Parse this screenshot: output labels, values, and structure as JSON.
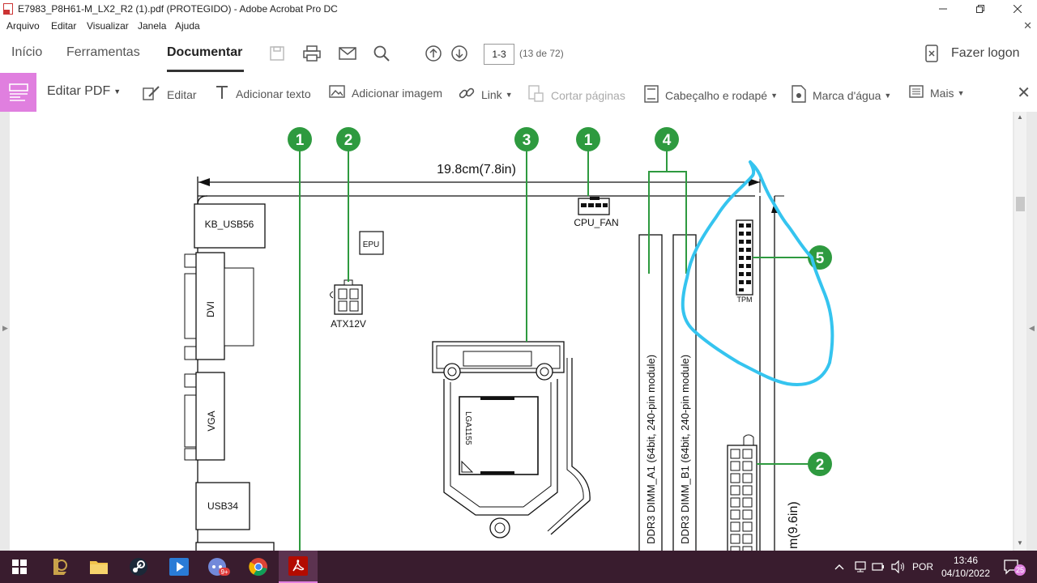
{
  "window": {
    "title": "E7983_P8H61-M_LX2_R2 (1).pdf (PROTEGIDO) - Adobe Acrobat Pro DC"
  },
  "menu": [
    "Arquivo",
    "Editar",
    "Visualizar",
    "Janela",
    "Ajuda"
  ],
  "tabs": [
    "Início",
    "Ferramentas",
    "Documentar"
  ],
  "toolbar": {
    "page_input": "1-3",
    "page_count": "(13 de 72)",
    "logon": "Fazer logon"
  },
  "editbar": {
    "main_label": "Editar PDF",
    "items": [
      "Editar",
      "Adicionar texto",
      "Adicionar imagem",
      "Link",
      "Cortar páginas",
      "Cabeçalho e rodapé",
      "Marca d'água",
      "Mais"
    ]
  },
  "diagram": {
    "width_label": "19.8cm(7.8in)",
    "height_label_partial": "m(9.6in)",
    "components": [
      "KB_USB56",
      "DVI",
      "VGA",
      "USB34",
      "EPU",
      "ATX12V",
      "CPU_FAN",
      "LGA1155",
      "TPM"
    ],
    "dimm_a1": "DDR3 DIMM_A1 (64bit, 240-pin module)",
    "dimm_b1": "DDR3 DIMM_B1 (64bit, 240-pin module)",
    "callouts": [
      "1",
      "2",
      "3",
      "1",
      "4",
      "5",
      "2"
    ],
    "accent_green": "#2e9a3f",
    "annotation_color": "#35c4ef"
  },
  "taskbar": {
    "language": "POR",
    "time": "13:46",
    "date": "04/10/2022",
    "notification_badge": "25",
    "discord_badge": "9+"
  }
}
